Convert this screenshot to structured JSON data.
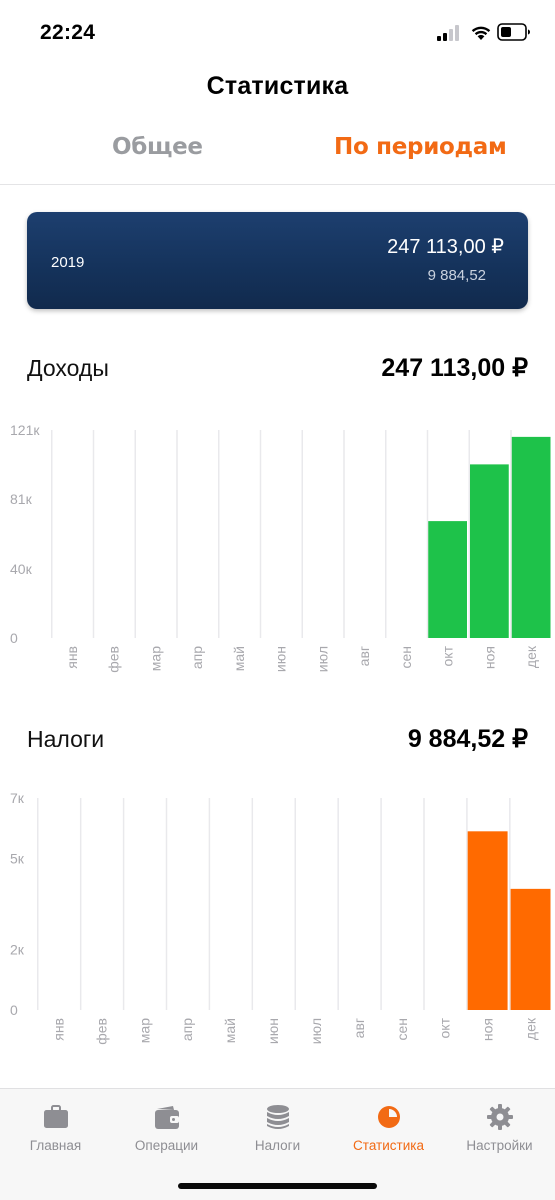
{
  "status_bar": {
    "time": "22:24"
  },
  "header": {
    "title": "Статистика"
  },
  "segments": {
    "general": "Общее",
    "periods": "По периодам",
    "active": "periods"
  },
  "year_card": {
    "year": "2019",
    "income": "247 113,00 ₽",
    "tax": "9 884,52"
  },
  "income_section": {
    "title": "Доходы",
    "total": "247 113,00 ₽"
  },
  "taxes_section": {
    "title": "Налоги",
    "total": "9 884,52 ₽"
  },
  "colors": {
    "accent": "#f26a14",
    "income_bar": "#1ec24a",
    "tax_bar": "#ff6a00",
    "card": "#15335c",
    "inactive": "#8e8e93"
  },
  "chart_data": [
    {
      "type": "bar",
      "categories": [
        "янв",
        "фев",
        "мар",
        "апр",
        "май",
        "июн",
        "июл",
        "авг",
        "сен",
        "окт",
        "ноя",
        "дек"
      ],
      "values": [
        0,
        0,
        0,
        0,
        0,
        0,
        0,
        0,
        0,
        68000,
        101000,
        117000
      ],
      "yticks": [
        0,
        40,
        81,
        121
      ],
      "ytick_labels": [
        "0",
        "40к",
        "81к",
        "121к"
      ],
      "ylim": [
        0,
        121000
      ],
      "grid": true,
      "color": "#1ec24a"
    },
    {
      "type": "bar",
      "categories": [
        "янв",
        "фев",
        "мар",
        "апр",
        "май",
        "июн",
        "июл",
        "авг",
        "сен",
        "окт",
        "ноя",
        "дек"
      ],
      "values": [
        0,
        0,
        0,
        0,
        0,
        0,
        0,
        0,
        0,
        0,
        5900,
        4000
      ],
      "yticks": [
        0,
        2,
        5,
        7
      ],
      "ytick_labels": [
        "0",
        "2к",
        "5к",
        "7к"
      ],
      "ylim": [
        0,
        7000
      ],
      "grid": true,
      "color": "#ff6a00"
    }
  ],
  "tab_bar": {
    "items": [
      {
        "label": "Главная",
        "icon": "briefcase-icon"
      },
      {
        "label": "Операции",
        "icon": "wallet-icon"
      },
      {
        "label": "Налоги",
        "icon": "coins-stack-icon"
      },
      {
        "label": "Статистика",
        "icon": "pie-chart-icon"
      },
      {
        "label": "Настройки",
        "icon": "gear-icon"
      }
    ],
    "active_index": 3
  }
}
